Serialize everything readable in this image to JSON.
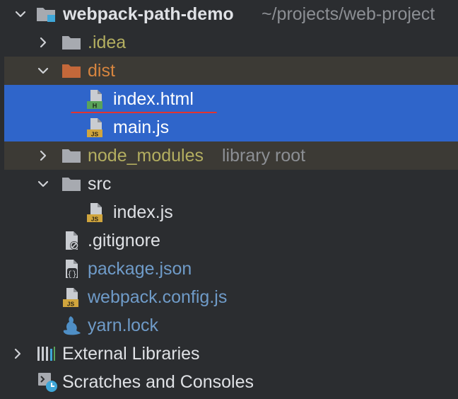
{
  "project": {
    "name": "webpack-path-demo",
    "path": "~/projects/web-project"
  },
  "items": [
    {
      "label": ".idea",
      "icon": "folder-icon"
    },
    {
      "label": "dist",
      "icon": "excluded-folder-icon"
    },
    {
      "label": "index.html",
      "icon": "html-file-icon",
      "badge": "H"
    },
    {
      "label": "main.js",
      "icon": "js-file-icon",
      "badge": "JS"
    },
    {
      "label": "node_modules",
      "icon": "folder-icon",
      "hint": "library root"
    },
    {
      "label": "src",
      "icon": "folder-icon"
    },
    {
      "label": "index.js",
      "icon": "js-file-icon",
      "badge": "JS"
    },
    {
      "label": ".gitignore",
      "icon": "ignored-file-icon"
    },
    {
      "label": "package.json",
      "icon": "json-file-icon"
    },
    {
      "label": "webpack.config.js",
      "icon": "js-file-icon",
      "badge": "JS"
    },
    {
      "label": "yarn.lock",
      "icon": "yarn-icon"
    }
  ],
  "external_libraries": {
    "label": "External Libraries",
    "icon": "library-icon"
  },
  "scratches": {
    "label": "Scratches and Consoles",
    "icon": "scratches-icon"
  },
  "colors": {
    "background": "#2b2d30",
    "selection": "#2f65ca",
    "excluded_band": "#3c3a35",
    "annotation_underline": "#e3342f"
  }
}
